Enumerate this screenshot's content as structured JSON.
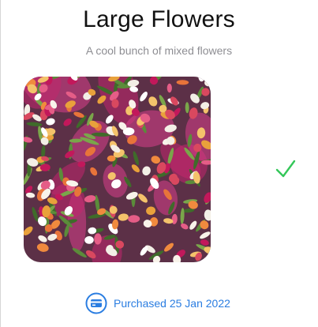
{
  "product": {
    "title": "Large Flowers",
    "subtitle": "A cool bunch of mixed flowers",
    "image_alt": "flower-bouquet"
  },
  "status": {
    "check_icon": "checkmark-icon",
    "check_color": "#34c759"
  },
  "purchase": {
    "icon": "credit-card-icon",
    "text": "Purchased 25 Jan 2022",
    "color": "#2a7de1"
  }
}
